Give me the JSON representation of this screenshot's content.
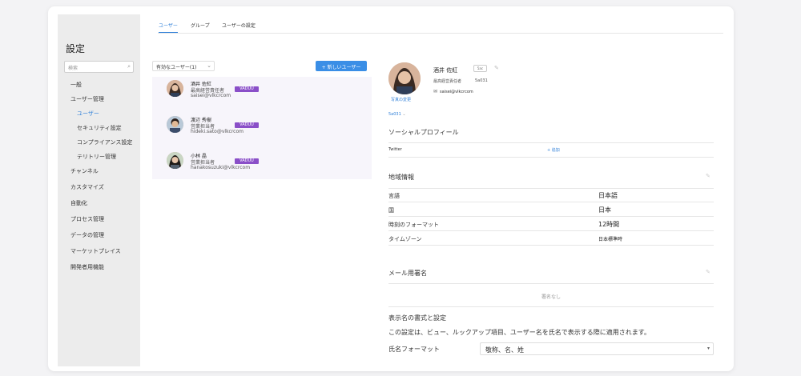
{
  "sidebar": {
    "title": "設定",
    "search_placeholder": "検索",
    "items": [
      {
        "label": "一般"
      },
      {
        "label": "ユーザー管理"
      },
      {
        "label": "ユーザー"
      },
      {
        "label": "セキュリティ設定"
      },
      {
        "label": "コンプライアンス設定"
      },
      {
        "label": "テリトリー管理"
      },
      {
        "label": "チャンネル"
      },
      {
        "label": "カスタマイズ"
      },
      {
        "label": "自動化"
      },
      {
        "label": "プロセス管理"
      },
      {
        "label": "データの管理"
      },
      {
        "label": "マーケットプレイス"
      },
      {
        "label": "開発者用機能"
      }
    ]
  },
  "tabs": [
    {
      "label": "ユーザー"
    },
    {
      "label": "グループ"
    },
    {
      "label": "ユーザーの設定"
    }
  ],
  "filter": {
    "label": "有効なユーザー(1)"
  },
  "new_user_button": {
    "label": "+ 新しいユーザー"
  },
  "users": [
    {
      "name": "酒井 佐紅",
      "role": "最高経営責任者",
      "email": "saisei@vlkcrcom",
      "badge": "VADUU"
    },
    {
      "name": "渡辺 秀樹",
      "role": "営業担当者",
      "email": "hideki.sato@vlkcrcom",
      "badge": "VADUU"
    },
    {
      "name": "小林 晶",
      "role": "営業担当者",
      "email": "hanakosuzuki@vlkcrcom",
      "badge": "VADUU"
    }
  ],
  "detail": {
    "photo_change": "写真の変更",
    "name": "酒井 佐紅",
    "chip": "5ac",
    "role": "最高経営責任者",
    "id": "5a031",
    "email": "saisei@vlkcrcom",
    "dropdown": "5a031",
    "social": {
      "title": "ソーシャルプロフィール",
      "label": "Twitter",
      "action": "+ 追加"
    },
    "locale": {
      "title": "地域情報",
      "rows": [
        {
          "label": "言語",
          "value": "日本語"
        },
        {
          "label": "国",
          "value": "日本"
        },
        {
          "label": "時刻のフォーマット",
          "value": "12時間"
        },
        {
          "label": "タイムゾーン",
          "value": "日本標準時"
        }
      ]
    },
    "signature": {
      "title": "メール用署名",
      "empty": "署名なし"
    },
    "name_format": {
      "title": "表示名の書式と設定",
      "description": "この設定は、ビュー、ルックアップ項目、ユーザー名を氏名で表示する際に適用されます。",
      "label": "氏名フォーマット",
      "value": "敬称、名、姓"
    }
  }
}
